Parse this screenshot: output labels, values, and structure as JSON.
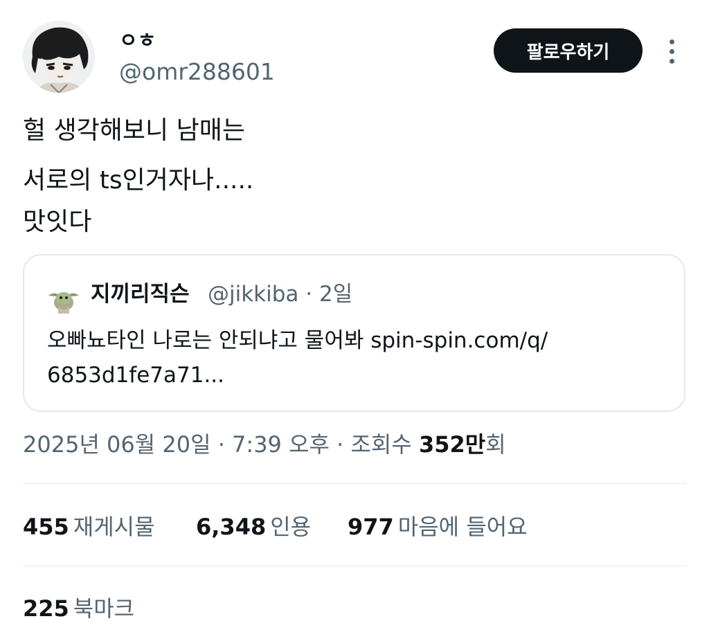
{
  "author": {
    "display_name": "ㅇㅎ",
    "handle": "@omr288601"
  },
  "actions": {
    "follow_label": "팔로우하기"
  },
  "tweet": {
    "lines": [
      "헐 생각해보니 남매는",
      "서로의 ts인거자나.....",
      "맛잇다"
    ]
  },
  "quote": {
    "name": "지끼리직슨",
    "handle_time": "@jikkiba · 2일",
    "lines": [
      "오빠뇨타인 나로는 안되냐고 물어봐 spin-spin.com/q/",
      "6853d1fe7a71..."
    ]
  },
  "meta": {
    "date_time": "2025년 06월 20일 · 7:39 오후 · 조회수 ",
    "views_value": "352만",
    "views_suffix": "회"
  },
  "stats": {
    "reposts": {
      "value": "455",
      "label": "재게시물"
    },
    "quotes": {
      "value": "6,348",
      "label": "인용"
    },
    "likes": {
      "value": "977",
      "label": "마음에 들어요"
    },
    "bookmarks": {
      "value": "225",
      "label": "북마크"
    }
  },
  "colors": {
    "text_primary": "#0f1419",
    "text_secondary": "#536471",
    "border": "#e4e8eb",
    "follow_button_bg": "#0f1419"
  },
  "icons": {
    "more": "more-vertical-icon"
  }
}
